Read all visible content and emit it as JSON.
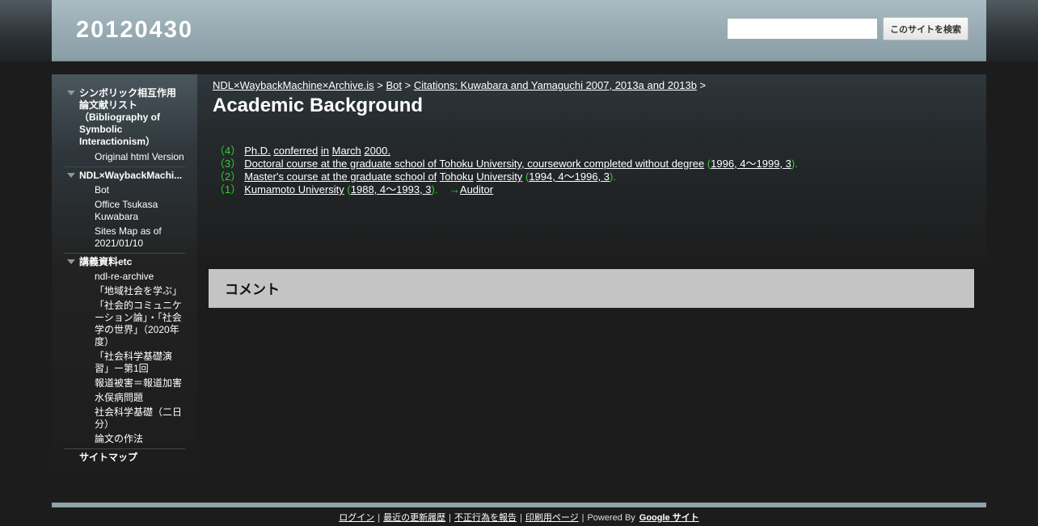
{
  "header": {
    "site_title": "20120430",
    "search_placeholder": "",
    "search_button": "このサイトを検索"
  },
  "sidebar": {
    "sections": [
      {
        "title": "シンボリック相互作用論文献リスト（Bibliography of Symbolic Interactionism）",
        "items": [
          "Original html Version"
        ]
      },
      {
        "title": "NDL×WaybackMachi...",
        "items": [
          "Bot",
          "Office Tsukasa Kuwabara",
          "Sites Map as of 2021/01/10"
        ]
      },
      {
        "title": "講義資料etc",
        "items": [
          "ndl-re-archive",
          "「地域社会を学ぶ」",
          "「社会的コミュニケーション論」・「社会学の世界」（2020年度）",
          "「社会科学基礎演習」ー第1回",
          "報道被害＝報道加害",
          "水俣病問題",
          "社会科学基礎（二日分）",
          "論文の作法"
        ]
      }
    ],
    "sitemap": "サイトマップ"
  },
  "breadcrumb": {
    "items": [
      "NDL×WaybackMachine×Archive.is",
      "Bot",
      "Citations: Kuwabara and Yamaguchi 2007, 2013a and 2013b"
    ],
    "separator": ">"
  },
  "page_title": "Academic Background",
  "entries": [
    {
      "num": "（4）",
      "parts": [
        "Ph.D.",
        "conferred",
        "in",
        "March",
        "2000."
      ]
    },
    {
      "num": "（3）",
      "text": "Doctoral course at the graduate school of Tohoku University, coursework completed without degree",
      "open": "(",
      "date": "1996, 4～1999, 3",
      "close": ")."
    },
    {
      "num": "（2）",
      "parts": [
        "Master's course at the graduate school of",
        "Tohoku",
        "University"
      ],
      "open": "(",
      "date": "1994, 4～1996, 3",
      "close": ")."
    },
    {
      "num": "（1）",
      "text": "Kumamoto University",
      "open": "(",
      "date": "1988, 4～1993, 3",
      "close": ").",
      "arrow": "→",
      "link": "Auditor"
    }
  ],
  "comment_title": "コメント",
  "footer": {
    "links": [
      "ログイン",
      "最近の更新履歴",
      "不正行為を報告",
      "印刷用ページ"
    ],
    "powered_by": "Powered By",
    "google_sites": "Google サイト"
  }
}
